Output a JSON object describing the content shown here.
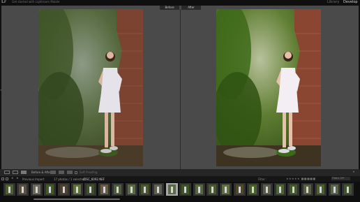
{
  "app": {
    "logo": "Lr",
    "title": "Get started with Lightroom Mobile",
    "modules": [
      "Library",
      "Develop"
    ],
    "active_module": "Develop"
  },
  "compare": {
    "before_label": "Before",
    "after_label": "After"
  },
  "toolbar": {
    "view_mode_label": "Before & After :",
    "soft_proofing_label": "Soft Proofing"
  },
  "filmstrip": {
    "source": "Previous Import",
    "count": "17 photos / 1 selected",
    "filename": "/DSC_6092.NEF",
    "filter_label": "Filter :",
    "filter_value": "Filters Off",
    "selected_index": 12
  },
  "colors": {
    "accent": "#d4d4d4",
    "view_bg": "#4a4a4a",
    "dress": "#e6e2ea",
    "brick": "#8a4630",
    "foliage": "#4c6030"
  },
  "icons": [
    "loupe-view-icon",
    "compare-view-icon",
    "before-after-icon",
    "swap-icon",
    "soft-proof-checkbox",
    "star-icon",
    "chevron-icon"
  ]
}
